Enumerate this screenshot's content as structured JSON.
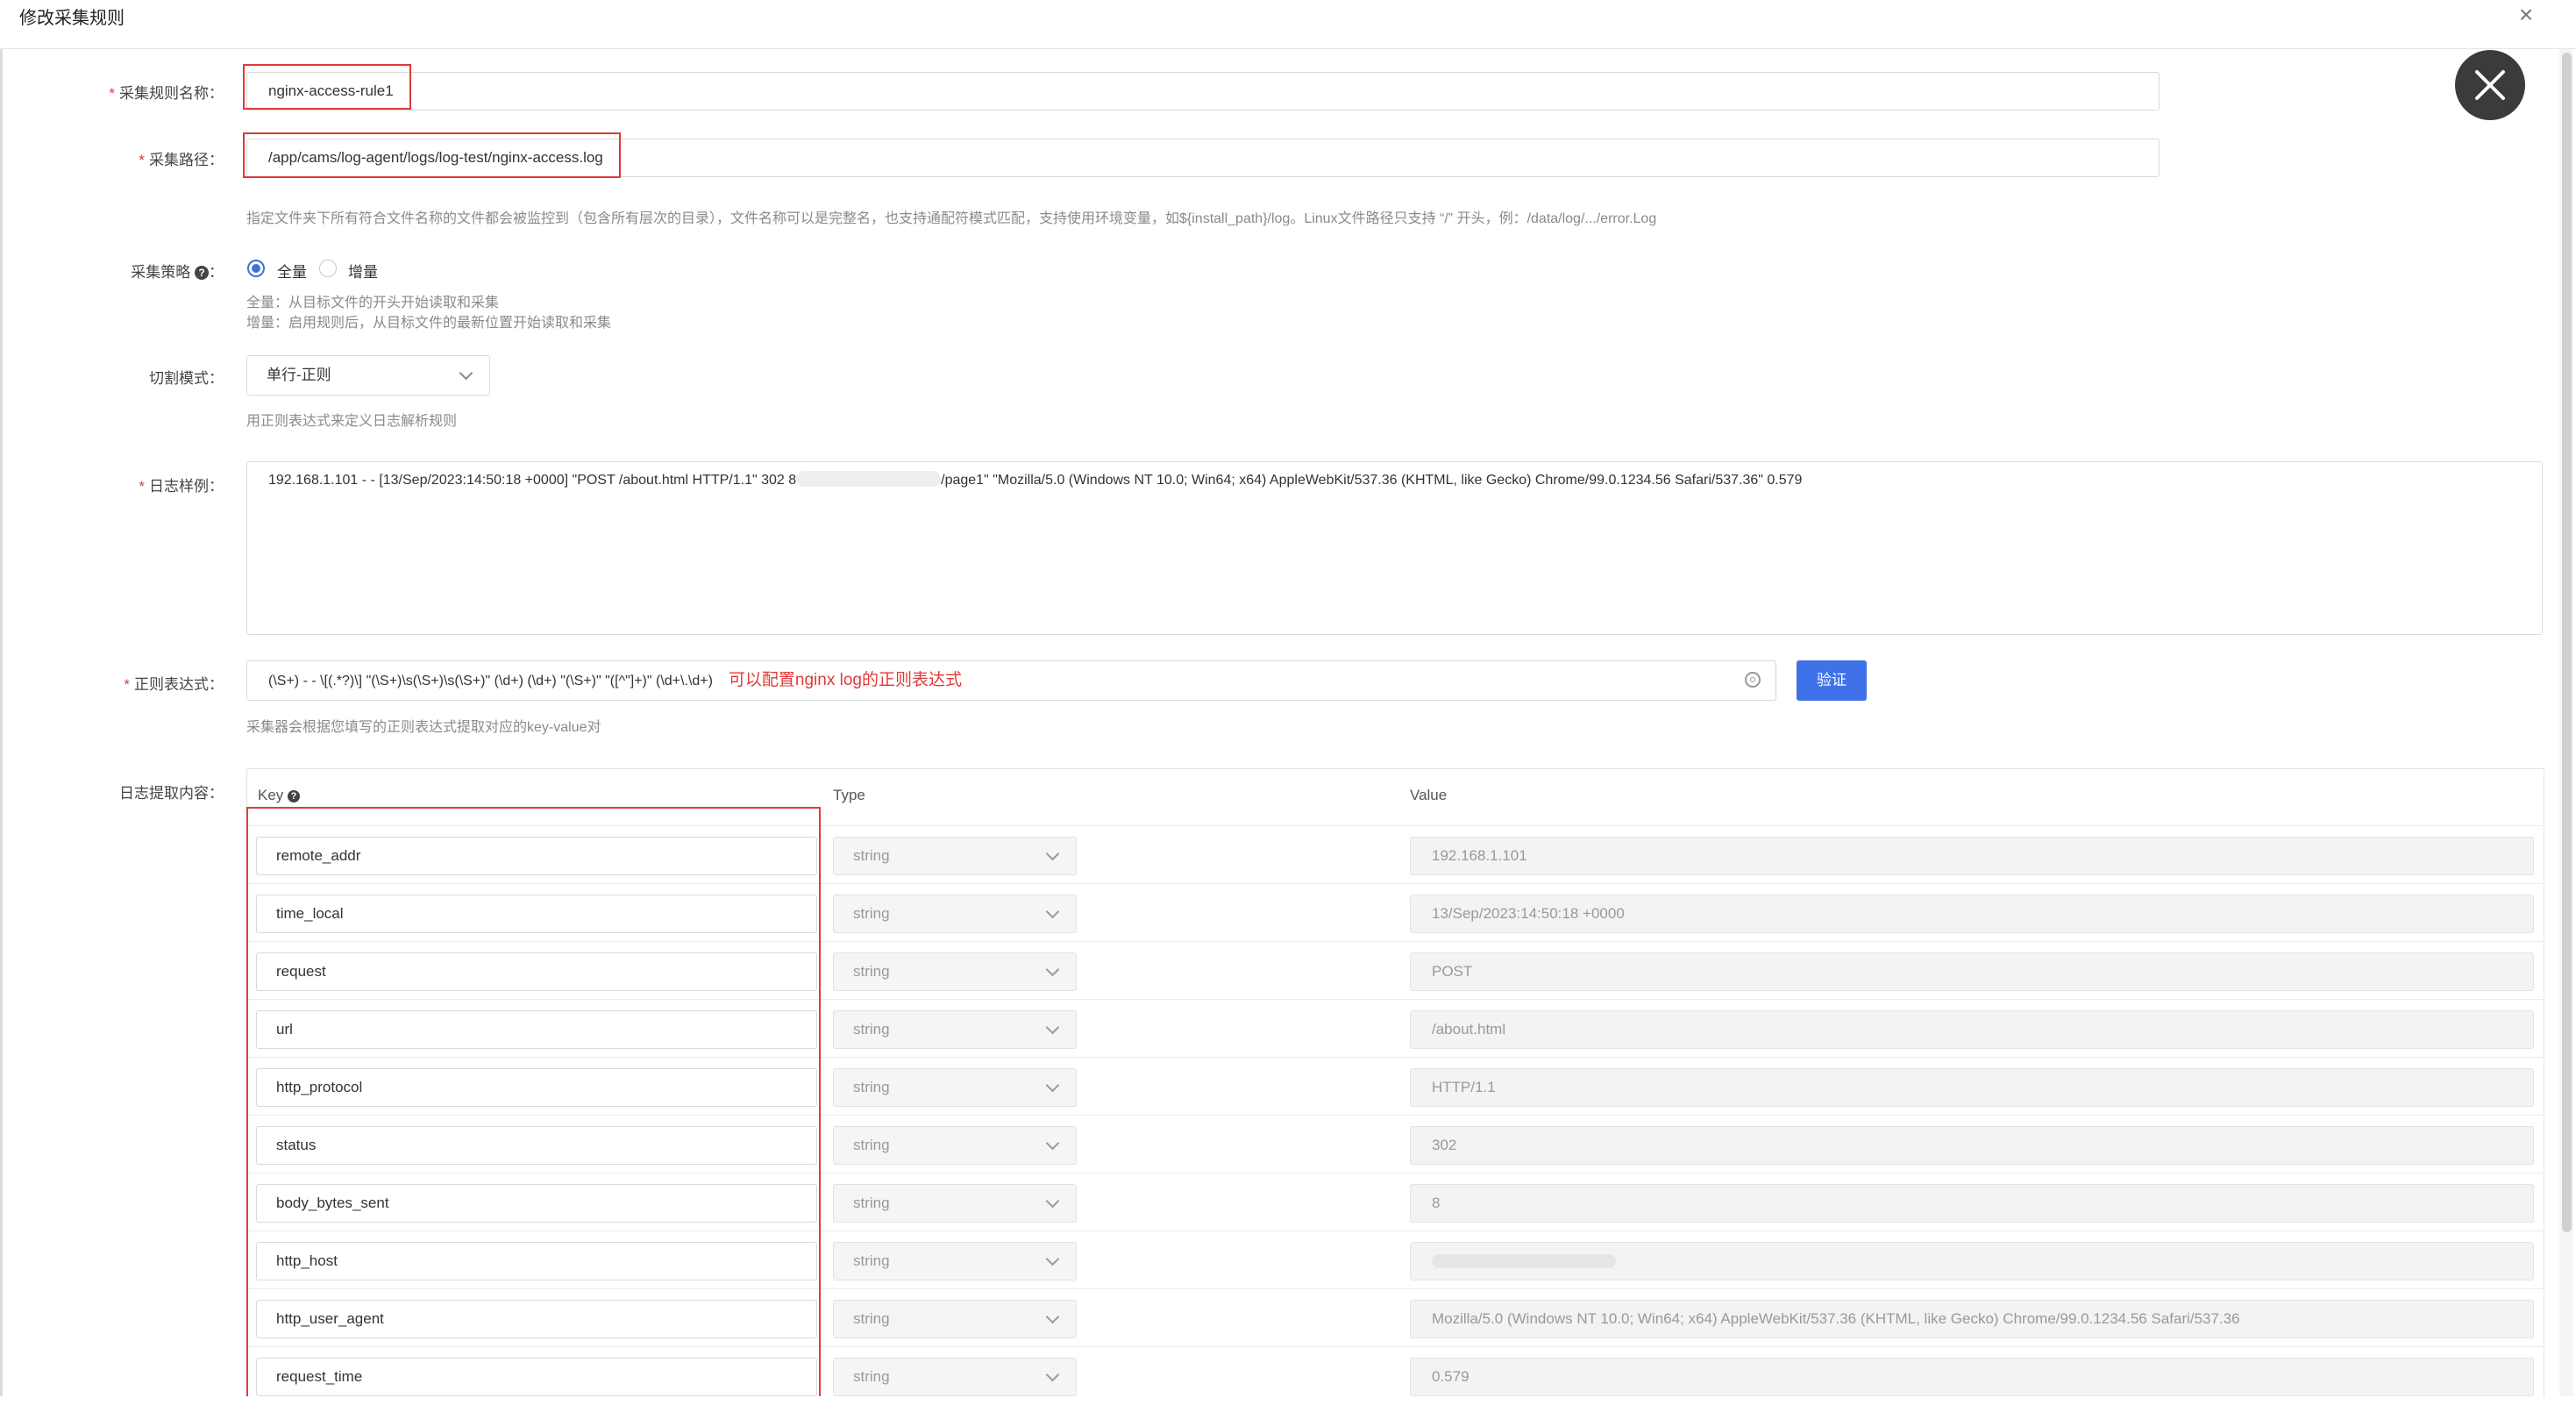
{
  "dialog": {
    "title": "修改采集规则"
  },
  "form": {
    "rule_name": {
      "label": "采集规则名称：",
      "value": "nginx-access-rule1"
    },
    "path": {
      "label": "采集路径：",
      "value": "/app/cams/log-agent/logs/log-test/nginx-access.log",
      "hint": "指定文件夹下所有符合文件名称的文件都会被监控到（包含所有层次的目录），文件名称可以是完整名，也支持通配符模式匹配，支持使用环境变量，如${install_path}/log。Linux文件路径只支持 “/” 开头，例：/data/log/.../error.Log"
    },
    "strategy": {
      "label": "采集策略",
      "options": [
        "全量",
        "增量"
      ],
      "selected": "全量",
      "hint_full": "全量：从目标文件的开头开始读取和采集",
      "hint_incr": "增量：启用规则后，从目标文件的最新位置开始读取和采集"
    },
    "split_mode": {
      "label": "切割模式：",
      "value": "单行-正则",
      "hint": "用正则表达式来定义日志解析规则"
    },
    "log_sample": {
      "label": "日志样例：",
      "part1": "192.168.1.101 - - [13/Sep/2023:14:50:18 +0000] \"POST /about.html HTTP/1.1\" 302 8",
      "part2": "/page1\" \"Mozilla/5.0 (Windows NT 10.0; Win64; x64) AppleWebKit/537.36 (KHTML, like Gecko) Chrome/99.0.1234.56 Safari/537.36\" 0.579"
    },
    "regex": {
      "label": "正则表达式：",
      "value": "(\\S+) - - \\[(.*?)\\] \"(\\S+)\\s(\\S+)\\s(\\S+)\" (\\d+) (\\d+) \"(\\S+)\" \"([^\"]+)\" (\\d+\\.\\d+)",
      "annotation": "可以配置nginx log的正则表达式",
      "verify_label": "验证",
      "hint": "采集器会根据您填写的正则表达式提取对应的key-value对"
    },
    "extract": {
      "label": "日志提取内容：",
      "col_key": "Key",
      "col_type": "Type",
      "col_value": "Value",
      "rows": [
        {
          "key": "remote_addr",
          "type": "string",
          "value": "192.168.1.101"
        },
        {
          "key": "time_local",
          "type": "string",
          "value": "13/Sep/2023:14:50:18 +0000"
        },
        {
          "key": "request",
          "type": "string",
          "value": "POST"
        },
        {
          "key": "url",
          "type": "string",
          "value": "/about.html"
        },
        {
          "key": "http_protocol",
          "type": "string",
          "value": "HTTP/1.1"
        },
        {
          "key": "status",
          "type": "string",
          "value": "302"
        },
        {
          "key": "body_bytes_sent",
          "type": "string",
          "value": "8"
        },
        {
          "key": "http_host",
          "type": "string",
          "value": ""
        },
        {
          "key": "http_user_agent",
          "type": "string",
          "value": "Mozilla/5.0 (Windows NT 10.0; Win64; x64) AppleWebKit/537.36 (KHTML, like Gecko) Chrome/99.0.1234.56 Safari/537.36"
        },
        {
          "key": "request_time",
          "type": "string",
          "value": "0.579"
        }
      ]
    }
  },
  "colors": {
    "accent": "#3f72e8",
    "annotation_red": "#e03a3a"
  }
}
